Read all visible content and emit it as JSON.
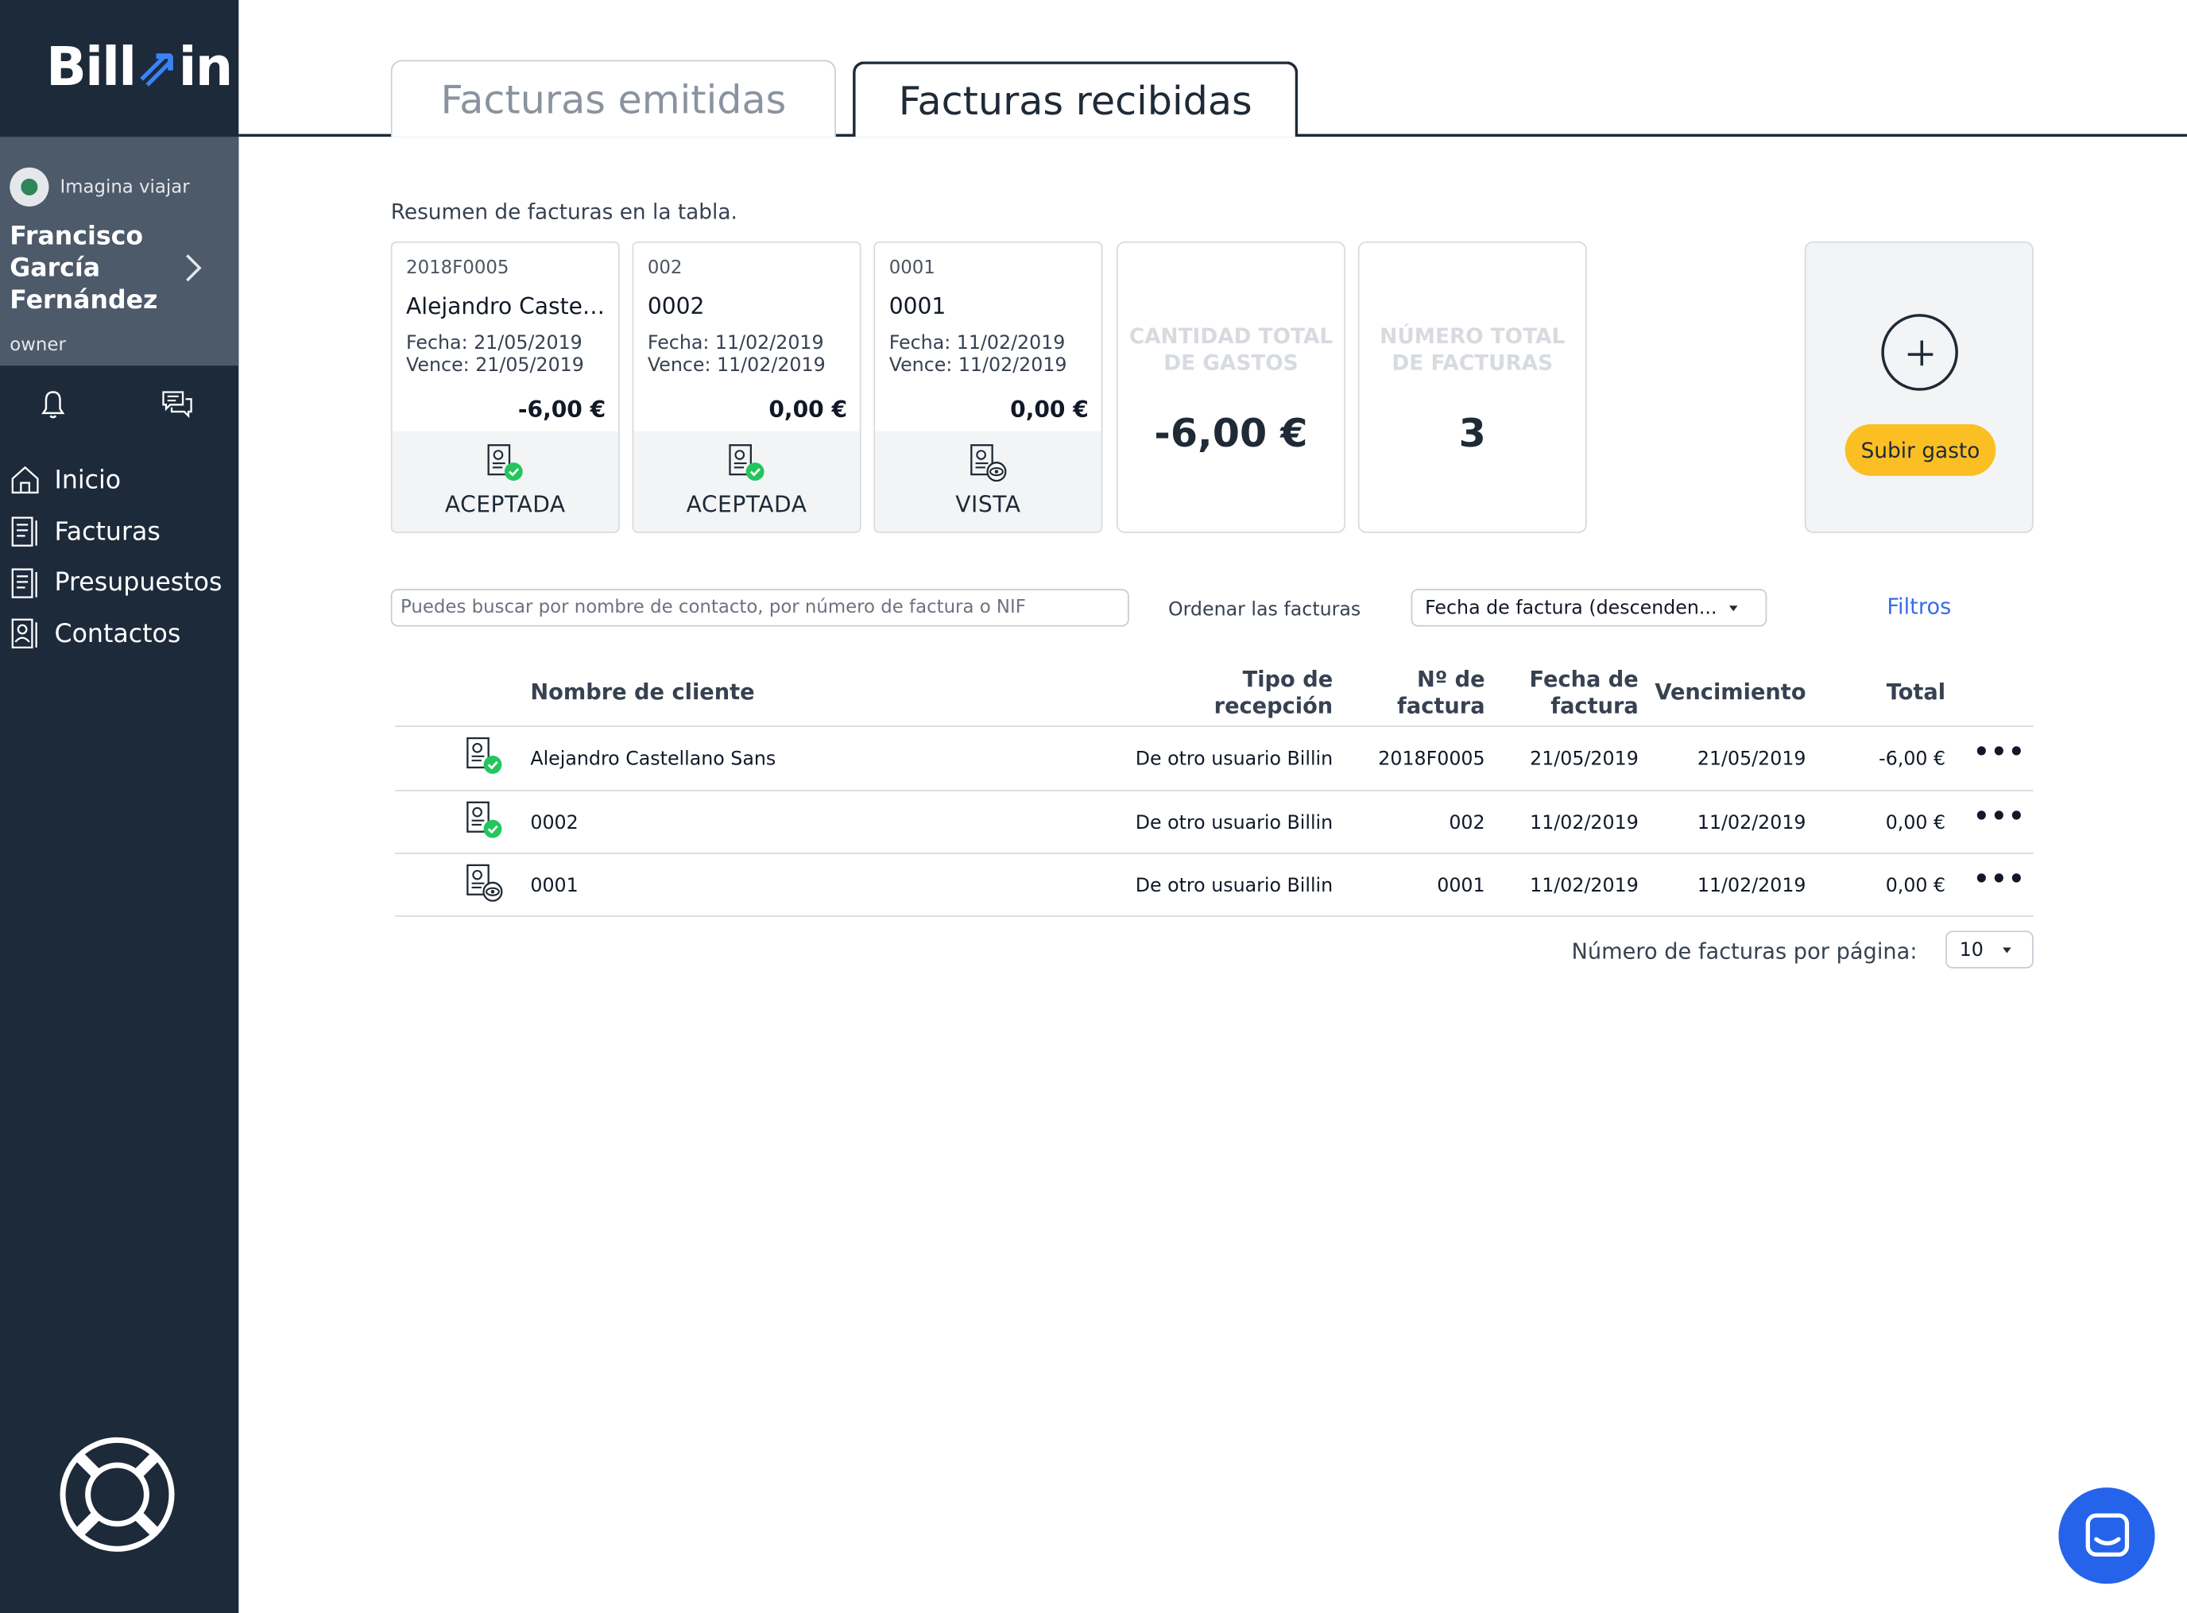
{
  "app": {
    "logo": "Billin"
  },
  "sidebar": {
    "company": "Imagina viajar",
    "user_name": "Francisco García Fernández",
    "role": "owner",
    "nav": [
      {
        "label": "Inicio",
        "icon": "home-icon"
      },
      {
        "label": "Facturas",
        "icon": "invoices-icon"
      },
      {
        "label": "Presupuestos",
        "icon": "budgets-icon"
      },
      {
        "label": "Contactos",
        "icon": "contacts-icon"
      }
    ]
  },
  "tabs": {
    "emitidas": "Facturas emitidas",
    "recibidas": "Facturas recibidas"
  },
  "summary_text": "Resumen de facturas en la tabla.",
  "cards": [
    {
      "number": "2018F0005",
      "client": "Alejandro Castell...",
      "fecha": "Fecha: 21/05/2019",
      "vence": "Vence: 21/05/2019",
      "amount": "-6,00 €",
      "status": "ACEPTADA",
      "status_icon": "invoice-accepted-icon"
    },
    {
      "number": "002",
      "client": "0002",
      "fecha": "Fecha: 11/02/2019",
      "vence": "Vence: 11/02/2019",
      "amount": "0,00 €",
      "status": "ACEPTADA",
      "status_icon": "invoice-accepted-icon"
    },
    {
      "number": "0001",
      "client": "0001",
      "fecha": "Fecha: 11/02/2019",
      "vence": "Vence: 11/02/2019",
      "amount": "0,00 €",
      "status": "VISTA",
      "status_icon": "invoice-viewed-icon"
    }
  ],
  "stats": {
    "total_amount_label": "CANTIDAD TOTAL DE GASTOS",
    "total_amount": "-6,00 €",
    "total_count_label": "NÚMERO TOTAL DE FACTURAS",
    "total_count": "3"
  },
  "upload": {
    "button": "Subir gasto"
  },
  "controls": {
    "search_placeholder": "Puedes buscar por nombre de contacto, por número de factura o NIF",
    "order_label": "Ordenar las facturas",
    "order_value": "Fecha de factura (descenden...",
    "filters": "Filtros"
  },
  "table": {
    "headers": {
      "client": "Nombre de cliente",
      "reception_1": "Tipo de",
      "reception_2": "recepción",
      "number_1": "Nº de",
      "number_2": "factura",
      "date_1": "Fecha de",
      "date_2": "factura",
      "due": "Vencimiento",
      "total": "Total"
    },
    "rows": [
      {
        "client": "Alejandro Castellano Sans",
        "reception": "De otro usuario Billin",
        "number": "2018F0005",
        "date": "21/05/2019",
        "due": "21/05/2019",
        "total": "-6,00 €",
        "icon": "invoice-accepted-icon"
      },
      {
        "client": "0002",
        "reception": "De otro usuario Billin",
        "number": "002",
        "date": "11/02/2019",
        "due": "11/02/2019",
        "total": "0,00 €",
        "icon": "invoice-accepted-icon"
      },
      {
        "client": "0001",
        "reception": "De otro usuario Billin",
        "number": "0001",
        "date": "11/02/2019",
        "due": "11/02/2019",
        "total": "0,00 €",
        "icon": "invoice-viewed-icon"
      }
    ],
    "more_label": "•••"
  },
  "pagination": {
    "label": "Número de facturas por página:",
    "value": "10"
  },
  "colors": {
    "sidebar": "#1c2a3a",
    "user_box": "#4c5a6a",
    "accent": "#3b6ee6",
    "upload_button": "#fbbf24",
    "accepted": "#22c55e",
    "chat": "#2563eb"
  }
}
